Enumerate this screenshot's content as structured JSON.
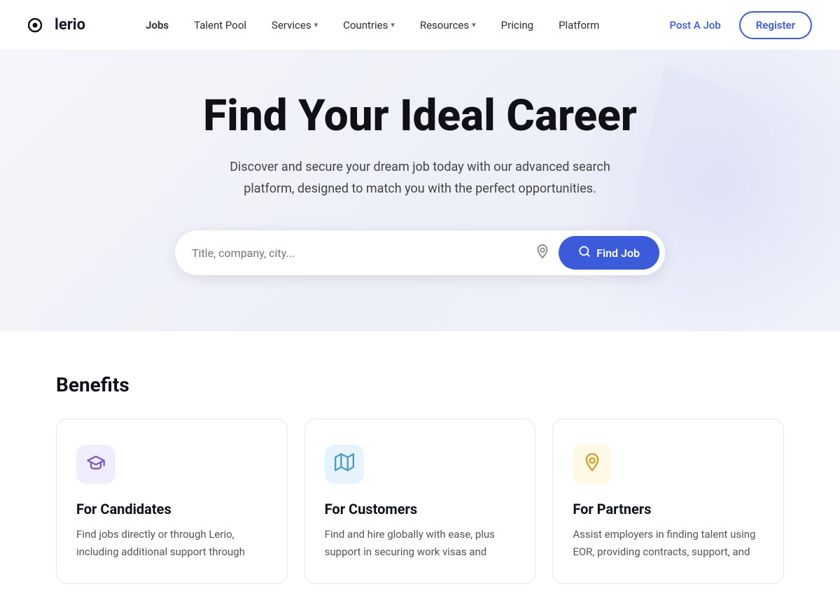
{
  "brand": {
    "name": "lerio",
    "logo_alt": "Lerio logo"
  },
  "nav": {
    "links": [
      {
        "label": "Jobs",
        "id": "jobs",
        "has_dropdown": false,
        "active": true
      },
      {
        "label": "Talent Pool",
        "id": "talent-pool",
        "has_dropdown": false,
        "active": false
      },
      {
        "label": "Services",
        "id": "services",
        "has_dropdown": true,
        "active": false
      },
      {
        "label": "Countries",
        "id": "countries",
        "has_dropdown": true,
        "active": false
      },
      {
        "label": "Resources",
        "id": "resources",
        "has_dropdown": true,
        "active": false
      },
      {
        "label": "Pricing",
        "id": "pricing",
        "has_dropdown": false,
        "active": false
      },
      {
        "label": "Platform",
        "id": "platform",
        "has_dropdown": false,
        "active": false
      }
    ],
    "post_job_label": "Post A Job",
    "register_label": "Register"
  },
  "hero": {
    "title": "Find Your Ideal Career",
    "subtitle": "Discover and secure your dream job today with our advanced search platform, designed to match you with the perfect opportunities.",
    "search_placeholder": "Title, company, city...",
    "find_job_label": "Find Job"
  },
  "benefits": {
    "section_title": "Benefits",
    "cards": [
      {
        "id": "candidates",
        "icon": "🎓",
        "icon_style": "icon-purple",
        "title": "For Candidates",
        "text": "Find jobs directly or through Lerio, including additional support through"
      },
      {
        "id": "customers",
        "icon": "🗺",
        "icon_style": "icon-blue",
        "title": "For Customers",
        "text": "Find and hire globally with ease, plus support in securing work visas and"
      },
      {
        "id": "partners",
        "icon": "📍",
        "icon_style": "icon-yellow",
        "title": "For Partners",
        "text": "Assist employers in finding talent using EOR, providing contracts, support, and"
      }
    ]
  }
}
